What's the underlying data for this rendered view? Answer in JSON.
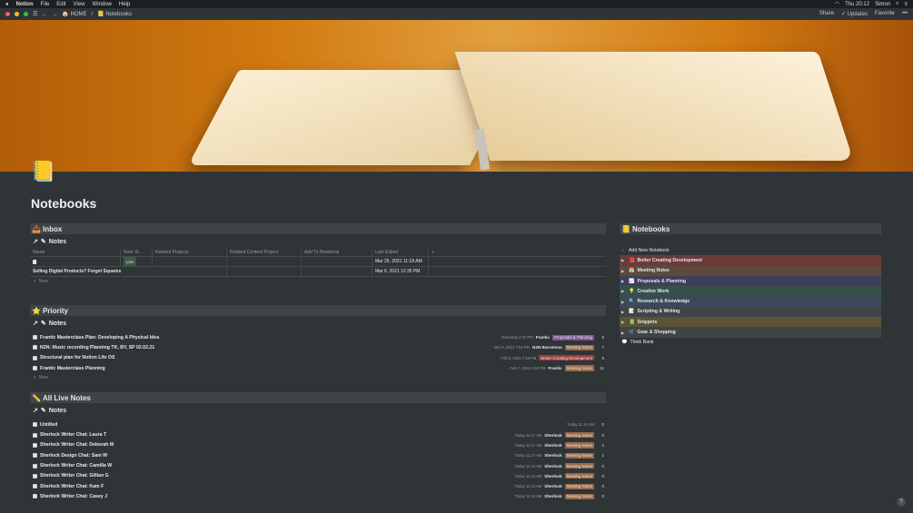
{
  "menubar": {
    "app_name": "Notion",
    "menus": [
      "File",
      "Edit",
      "View",
      "Window",
      "Help"
    ],
    "clock": "Thu 20:12",
    "user": "Simon"
  },
  "titlebar": {
    "breadcrumb_home": "HOME",
    "breadcrumb_page": "Notebooks",
    "share_label": "Share",
    "updates_label": "Updates",
    "favorite_label": "Favorite"
  },
  "page": {
    "icon": "📒",
    "title": "Notebooks"
  },
  "inbox": {
    "heading": "Inbox",
    "heading_icon": "📥",
    "view_label": "Notes",
    "columns": [
      "Name",
      "Note St...",
      "Related Projects",
      "Related Content Project",
      "Add To Notebook",
      "Last Edited"
    ],
    "rows": [
      {
        "name": "",
        "status": "Live",
        "last_edited": "Mar 25, 2021 11:18 AM"
      },
      {
        "name": "Selling Digital Products? Forget Squares",
        "status": "",
        "last_edited": "Mar 6, 2021 12:35 PM"
      }
    ],
    "new_label": "New"
  },
  "priority": {
    "heading": "Priority",
    "heading_icon": "⭐",
    "view_label": "Notes",
    "rows": [
      {
        "name": "Frantic Masterclass Plan: Developing A Physical Idea",
        "date": "Yesterday 2:37 PM",
        "who": "Frantic",
        "tag": "Proposals & Planning",
        "tag_class": "pp",
        "count": "5"
      },
      {
        "name": "N2N: Music recording Planning TK, BY, SP 02.02.21",
        "date": "Mar 9, 2021 7:02 PM",
        "who": "N2N Barcelona",
        "tag": "Meeting Notes",
        "tag_class": "mn",
        "count": "7"
      },
      {
        "name": "Structural plan for Notion Life OS",
        "date": "Feb 8, 2021 7:26 PM",
        "who": "",
        "tag": "Better Creating Development",
        "tag_class": "bcd",
        "count": "6"
      },
      {
        "name": "Frantic Masterclass Planning",
        "date": "Feb 7, 2021 1:53 PM",
        "who": "Frantic",
        "tag": "Meeting Notes",
        "tag_class": "mn",
        "count": "11"
      }
    ],
    "new_label": "New"
  },
  "all_live": {
    "heading": "All Live Notes",
    "heading_icon": "✏️",
    "view_label": "Notes",
    "rows": [
      {
        "name": "Untitled",
        "date": "Today 11:16 AM",
        "who": "",
        "tag": "",
        "tag_class": "",
        "count": "0"
      },
      {
        "name": "Sherlock Writer Chat: Laura T",
        "date": "Today 11:17 AM",
        "who": "Sherlock",
        "tag": "Meeting Notes",
        "tag_class": "mn",
        "count": "0"
      },
      {
        "name": "Sherlock Writer Chat: Deborah M",
        "date": "Today 11:17 AM",
        "who": "Sherlock",
        "tag": "Meeting Notes",
        "tag_class": "mn",
        "count": "1"
      },
      {
        "name": "Sherlock Design Chat: Sam W",
        "date": "Today 11:17 AM",
        "who": "Sherlock",
        "tag": "Meeting Notes",
        "tag_class": "mn",
        "count": "1"
      },
      {
        "name": "Sherlock Writer Chat: Camilla W",
        "date": "Today 11:16 AM",
        "who": "Sherlock",
        "tag": "Meeting Notes",
        "tag_class": "mn",
        "count": "0"
      },
      {
        "name": "Sherlock Writer Chat: Gillian G",
        "date": "Today 11:16 AM",
        "who": "Sherlock",
        "tag": "Meeting Notes",
        "tag_class": "mn",
        "count": "0"
      },
      {
        "name": "Sherlock Writer Chat: Kate F",
        "date": "Today 11:16 AM",
        "who": "Sherlock",
        "tag": "Meeting Notes",
        "tag_class": "mn",
        "count": "0"
      },
      {
        "name": "Sherlock Writer Chat: Casey J",
        "date": "Today 11:16 AM",
        "who": "Sherlock",
        "tag": "Meeting Notes",
        "tag_class": "mn",
        "count": "0"
      }
    ]
  },
  "notebooks": {
    "heading": "Notebooks",
    "heading_icon": "📒",
    "add_label": "Add New Notebook",
    "items": [
      {
        "icon": "📕",
        "label": "Better Creating Development",
        "color": "#6b3b3b"
      },
      {
        "icon": "📅",
        "label": "Meeting Notes",
        "color": "#5e4a3b"
      },
      {
        "icon": "📈",
        "label": "Proposals & Planning",
        "color": "#3d3f5c"
      },
      {
        "icon": "💡",
        "label": "Creative Work",
        "color": "#37504a"
      },
      {
        "icon": "🔍",
        "label": "Research & Knowledge",
        "color": "#3a4a5a"
      },
      {
        "icon": "📝",
        "label": "Scripting & Writing",
        "color": "#3f4447"
      },
      {
        "icon": "📗",
        "label": "Snippets",
        "color": "#5a5433"
      },
      {
        "icon": "🛒",
        "label": "Gear & Shopping",
        "color": "#3f4447"
      }
    ],
    "think_bank_icon": "💭",
    "think_bank_label": "Think Bank"
  },
  "help_label": "?"
}
